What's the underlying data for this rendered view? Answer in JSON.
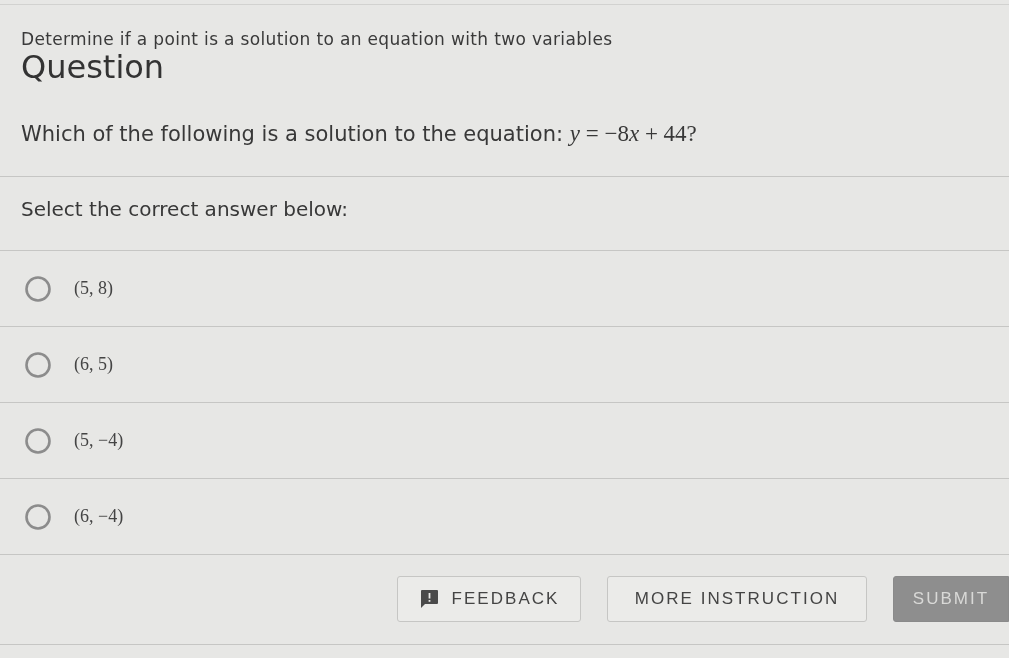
{
  "subtitle": "Determine if a point is a solution to an equation with two variables",
  "heading": "Question",
  "question": {
    "text": "Which of the following is a solution to the equation:",
    "equation": [
      {
        "text": "y",
        "italic": true
      },
      {
        "text": " = −8",
        "italic": false
      },
      {
        "text": "x",
        "italic": true
      },
      {
        "text": " + 44",
        "italic": false
      }
    ],
    "suffix": "?"
  },
  "prompt": "Select the correct answer below:",
  "options": [
    {
      "label": "(5, 8)",
      "selected": false
    },
    {
      "label": "(6, 5)",
      "selected": false
    },
    {
      "label": "(5, −4)",
      "selected": false
    },
    {
      "label": "(6, −4)",
      "selected": false
    }
  ],
  "buttons": [
    {
      "label": "FEEDBACK",
      "kind": "feedback",
      "disabled": false
    },
    {
      "label": "MORE INSTRUCTION",
      "kind": "plain",
      "disabled": false
    },
    {
      "label": "SUBMIT",
      "kind": "primary",
      "disabled": true
    }
  ]
}
